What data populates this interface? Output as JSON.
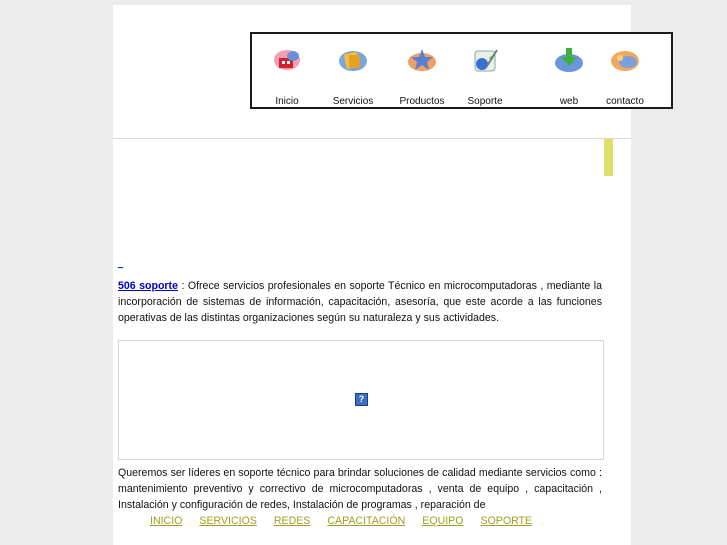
{
  "colors": {
    "accent_bar": "#dede6a",
    "link": "#0000cc",
    "footer_link": "#a0a020"
  },
  "nav": {
    "items": [
      {
        "label": "Inicio",
        "icon": "home-icon"
      },
      {
        "label": "Servicios",
        "icon": "services-icon"
      },
      {
        "label": "Productos",
        "icon": "products-icon"
      },
      {
        "label": "Soporte",
        "icon": "support-icon"
      },
      {
        "label": "web",
        "icon": "web-download-icon"
      },
      {
        "label": "contacto",
        "icon": "contact-icon"
      }
    ]
  },
  "content": {
    "tiny_link": "_",
    "brand_link": "506 soporte",
    "intro_text": " :  Ofrece servicios profesionales en soporte Técnico en microcomputadoras , mediante la incorporación de sistemas de información, capacitación, asesoría,  que este acorde a las funciones operativas de las distintas organizaciones según su naturaleza y sus actividades.",
    "broken_image_glyph": "?",
    "mission_text": "Queremos ser líderes en soporte técnico para brindar soluciones  de calidad mediante servicios como : mantenimiento preventivo y correctivo de microcomputadoras , venta de equipo , capacitación , Instalación y configuración de redes, Instalación de programas , reparación de"
  },
  "footer": {
    "links": [
      "INICIO",
      "SERVICIOS",
      "REDES",
      "CAPACITACIÓN",
      "EQUIPO",
      "SOPORTE"
    ]
  }
}
